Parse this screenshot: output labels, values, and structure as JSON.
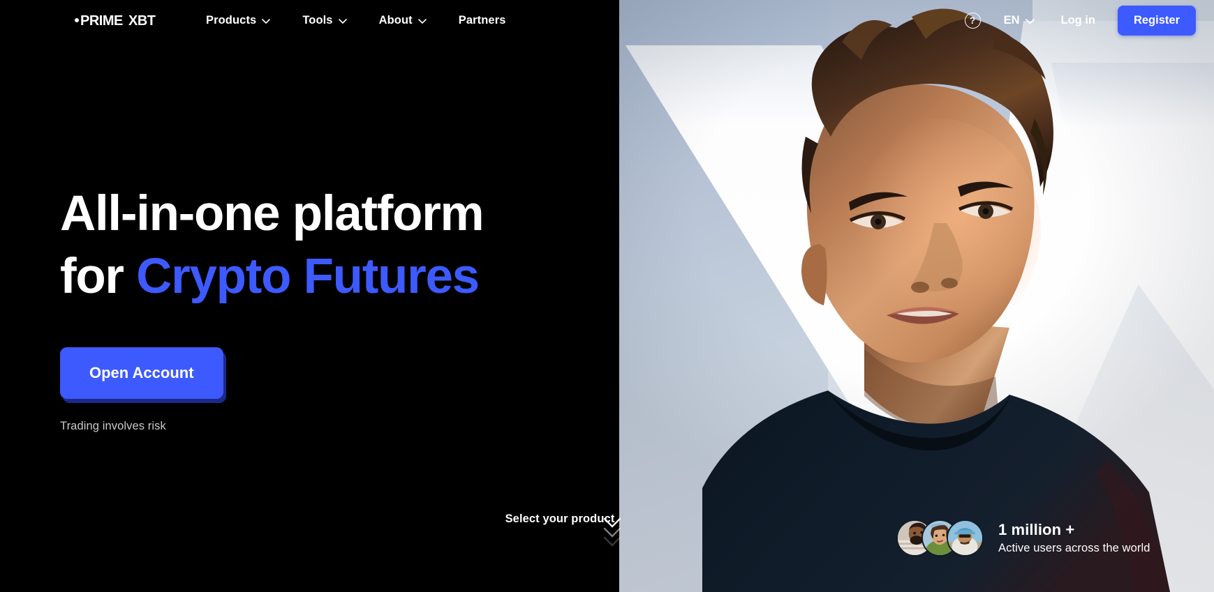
{
  "brand": {
    "logo_text": "PRIME XBT",
    "accent_color": "#3d5afe"
  },
  "header": {
    "nav": [
      {
        "label": "Products",
        "has_dropdown": true,
        "icon": "chevron-down-icon"
      },
      {
        "label": "Tools",
        "has_dropdown": true,
        "icon": "chevron-down-icon"
      },
      {
        "label": "About",
        "has_dropdown": true,
        "icon": "chevron-down-icon"
      },
      {
        "label": "Partners",
        "has_dropdown": false,
        "icon": ""
      }
    ],
    "help_icon": "question-mark-icon",
    "help_glyph": "?",
    "language": "EN",
    "language_icon": "chevron-down-icon",
    "login_label": "Log in",
    "register_label": "Register"
  },
  "hero": {
    "headline_line1": "All-in-one platform",
    "headline_line2_prefix": "for ",
    "headline_line2_accent": "Crypto Futures",
    "cta_label": "Open Account",
    "risk_note": "Trading involves risk"
  },
  "scroll_hint": {
    "label": "Select your product",
    "icon": "double-chevron-down-icon"
  },
  "users_badge": {
    "count": "1 million +",
    "subtitle": "Active users across the world",
    "avatar_count": 3
  }
}
